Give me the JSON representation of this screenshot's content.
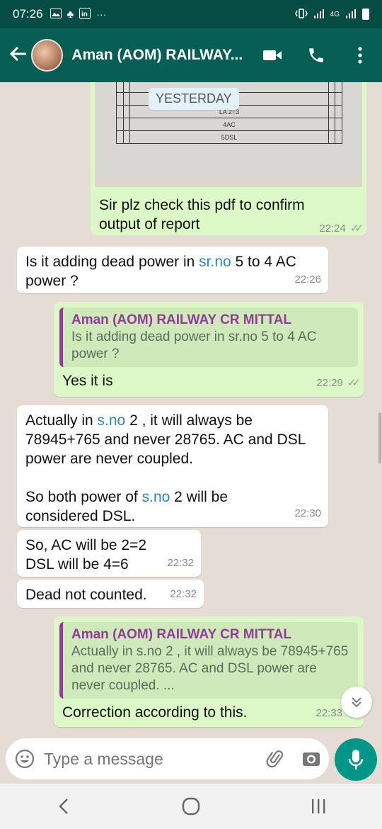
{
  "status": {
    "time": "07:26",
    "network": "4G"
  },
  "header": {
    "contact_name": "Aman (AOM) RAILWAY..."
  },
  "image_message": {
    "table_rows": [
      "LA 2=3",
      "4AC",
      "5DSL"
    ],
    "caption_line1": "Sir plz check this pdf to confirm",
    "caption_line2": "output of report",
    "time": "22:24",
    "ticks": "✓✓"
  },
  "day_separator": "YESTERDAY",
  "messages": [
    {
      "dir": "in",
      "pre": "Is it adding dead power in ",
      "link": "sr.no",
      "post": " 5 to 4 AC power ?",
      "time": "22:26"
    },
    {
      "dir": "out",
      "quote_name": "Aman (AOM) RAILWAY CR MITTAL",
      "quote_text": "Is it adding dead power in sr.no 5 to 4 AC power ?",
      "text": "Yes it is",
      "time": "22:29",
      "ticks": "✓✓"
    },
    {
      "dir": "in",
      "pre": "Actually in ",
      "link": "s.no",
      "post": " 2 , it will always be 78945+765 and never 28765. AC and DSL power are never coupled.",
      "pre2": "So both power of ",
      "link2": "s.no",
      "post2": " 2 will be considered DSL.",
      "time": "22:30"
    },
    {
      "dir": "in",
      "line1": "So, AC will be 2=2",
      "line2": "DSL will be 4=6",
      "time": "22:32"
    },
    {
      "dir": "in",
      "text": "Dead not counted.",
      "time": "22:32"
    },
    {
      "dir": "out",
      "quote_name": "Aman (AOM) RAILWAY CR MITTAL",
      "quote_text": "Actually in s.no 2 , it will always be 78945+765 and never 28765. AC and DSL power are never coupled. ...",
      "text": "Correction according to this.",
      "time": "22:33"
    }
  ],
  "input": {
    "placeholder": "Type a message"
  }
}
